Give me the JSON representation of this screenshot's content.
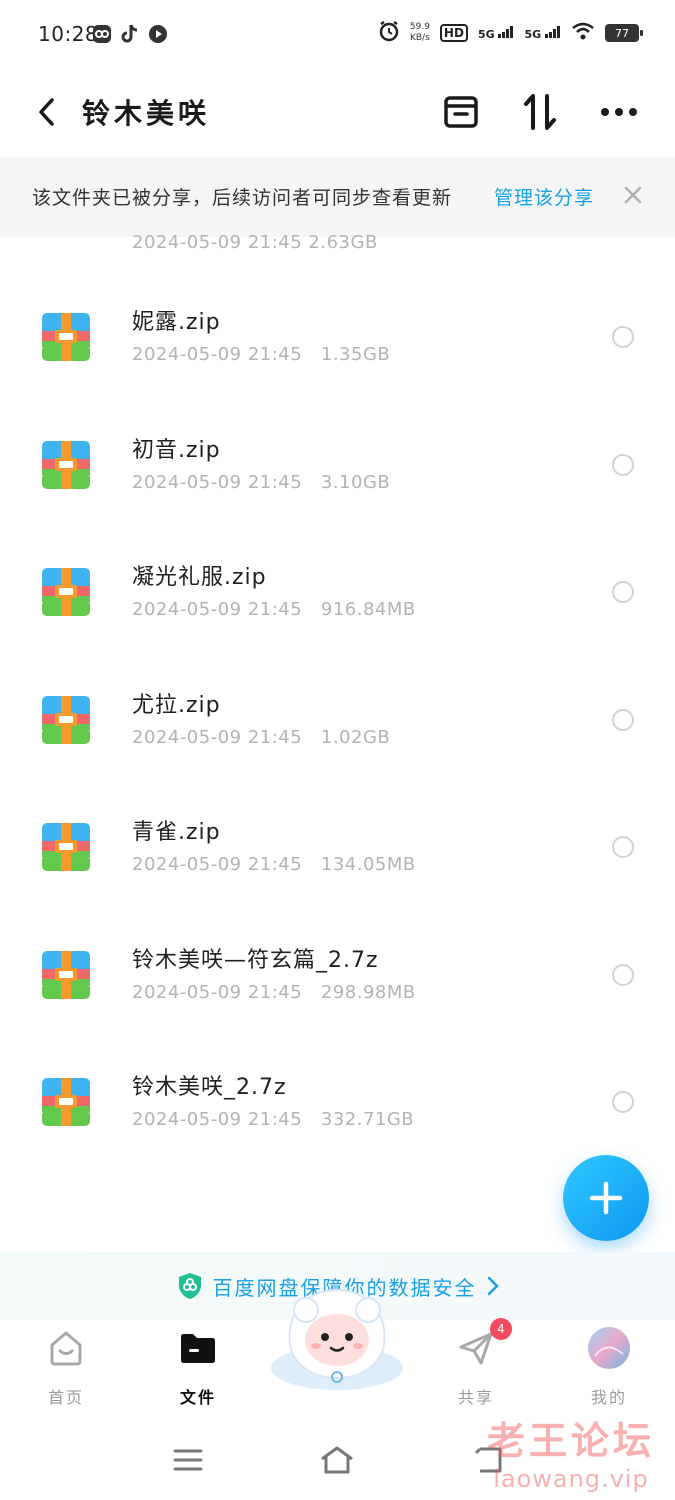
{
  "status_bar": {
    "time": "10:28",
    "net_speed_value": "59.9",
    "net_speed_unit": "KB/s",
    "hd_badge": "HD",
    "signal1": "5G",
    "signal2": "5G",
    "battery": "77",
    "icons": [
      "baidu-netdisk-icon",
      "tiktok-icon",
      "play-icon",
      "alarm-icon",
      "wifi-icon"
    ]
  },
  "header": {
    "title": "铃木美咲",
    "back_icon": "chevron-left-icon",
    "actions": [
      "archive-icon",
      "sort-icon",
      "more-icon"
    ]
  },
  "share_banner": {
    "text": "该文件夹已被分享，后续访问者可同步查看更新",
    "link": "管理该分享",
    "close_icon": "close-icon"
  },
  "partial_row_meta": "2024-05-09  21:45   2.63GB",
  "files": [
    {
      "name": "妮露.zip",
      "date": "2024-05-09  21:45",
      "size": "1.35GB"
    },
    {
      "name": "初音.zip",
      "date": "2024-05-09  21:45",
      "size": "3.10GB"
    },
    {
      "name": "凝光礼服.zip",
      "date": "2024-05-09  21:45",
      "size": "916.84MB"
    },
    {
      "name": "尤拉.zip",
      "date": "2024-05-09  21:45",
      "size": "1.02GB"
    },
    {
      "name": "青雀.zip",
      "date": "2024-05-09  21:45",
      "size": "134.05MB"
    },
    {
      "name": "铃木美咲—符玄篇_2.7z",
      "date": "2024-05-09  21:45",
      "size": "298.98MB"
    },
    {
      "name": "铃木美咲_2.7z",
      "date": "2024-05-09  21:45",
      "size": "332.71GB"
    }
  ],
  "safety_strip": {
    "text": "百度网盘保障你的数据安全",
    "icon": "shield-icon"
  },
  "bottom_nav": {
    "home": "首页",
    "files": "文件",
    "share": "共享",
    "share_badge": "4",
    "mine": "我的"
  },
  "watermark": {
    "cn": "老王论坛",
    "en": "laowang.vip"
  },
  "colors": {
    "accent": "#1aa0e4",
    "badge": "#f44a5d",
    "meta": "#b3b3b3"
  }
}
